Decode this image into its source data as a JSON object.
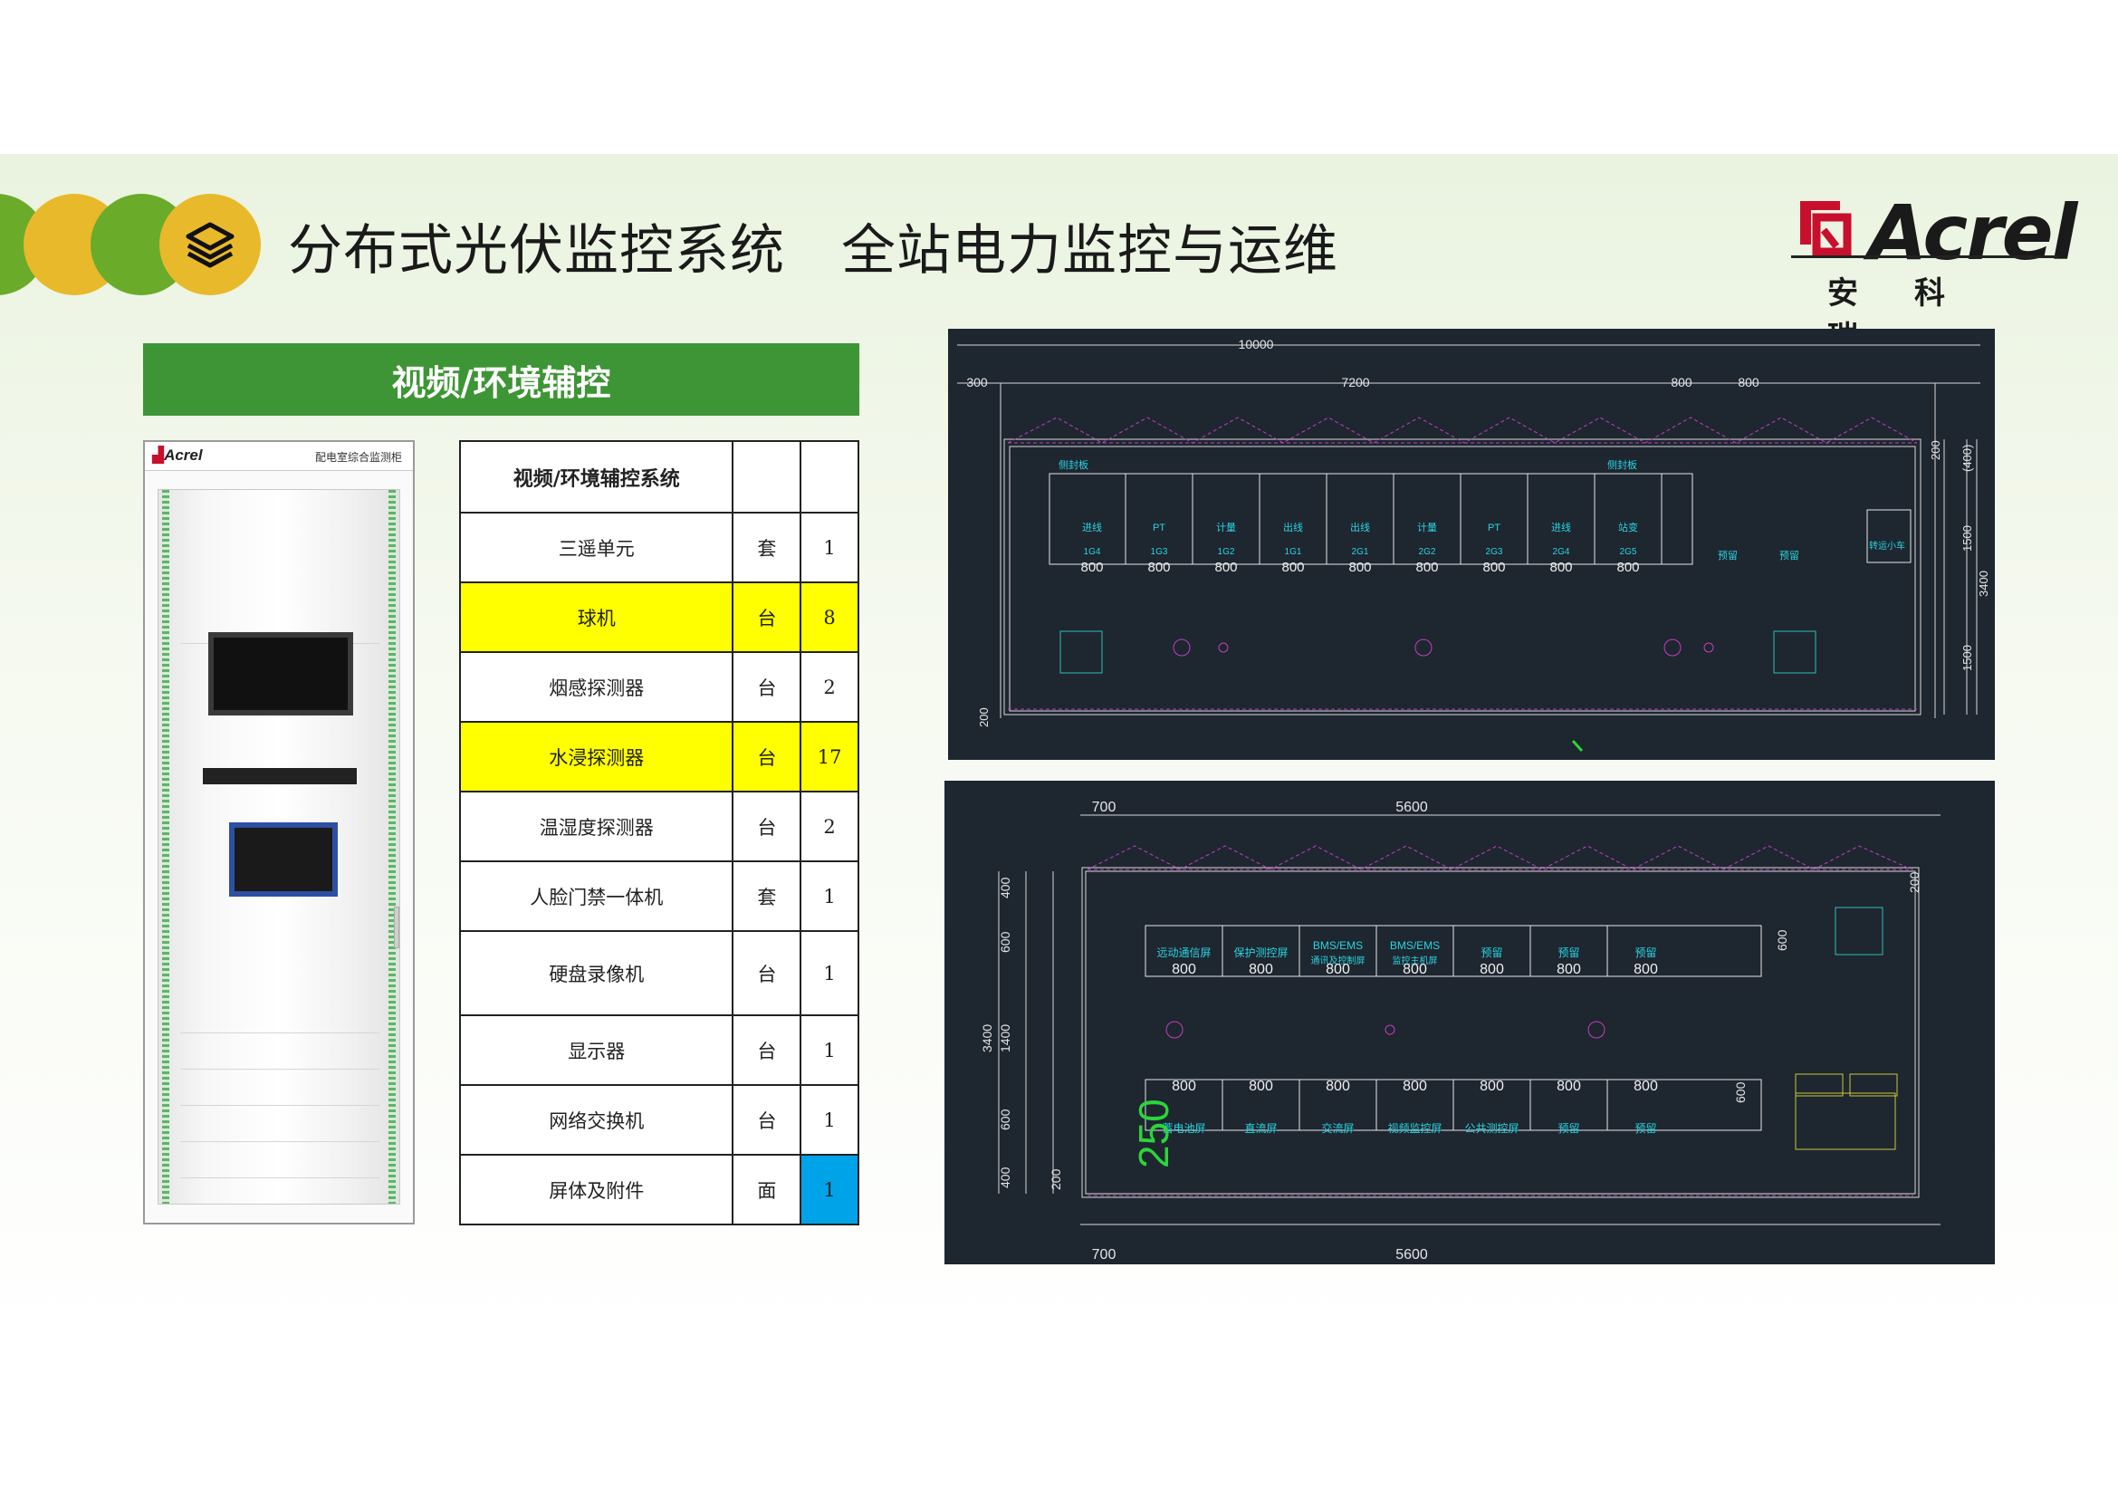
{
  "header": {
    "title_left": "分布式光伏监控系统",
    "title_right": "全站电力监控与运维",
    "layers_icon": "layers-icon",
    "circle_colors": [
      "#6aab2a",
      "#e8b92b",
      "#6aab2a",
      "#e8b92b"
    ]
  },
  "logo": {
    "word": "Acrel",
    "chinese": [
      "安",
      "科",
      "瑞"
    ],
    "mark_color": "#c8102e"
  },
  "section": {
    "title": "视频/环境辅控"
  },
  "cabinet": {
    "brand": "Acrel",
    "name": "配电室综合监测柜"
  },
  "table": {
    "header": "视频/环境辅控系统",
    "rows": [
      {
        "name": "三遥单元",
        "unit": "套",
        "qty": "1",
        "highlight": ""
      },
      {
        "name": "球机",
        "unit": "台",
        "qty": "8",
        "highlight": "yellow"
      },
      {
        "name": "烟感探测器",
        "unit": "台",
        "qty": "2",
        "highlight": ""
      },
      {
        "name": "水浸探测器",
        "unit": "台",
        "qty": "17",
        "highlight": "yellow"
      },
      {
        "name": "温湿度探测器",
        "unit": "台",
        "qty": "2",
        "highlight": ""
      },
      {
        "name": "人脸门禁一体机",
        "unit": "套",
        "qty": "1",
        "highlight": ""
      },
      {
        "name": "硬盘录像机",
        "unit": "台",
        "qty": "1",
        "highlight": ""
      },
      {
        "name": "显示器",
        "unit": "台",
        "qty": "1",
        "highlight": ""
      },
      {
        "name": "网络交换机",
        "unit": "台",
        "qty": "1",
        "highlight": ""
      },
      {
        "name": "屏体及附件",
        "unit": "面",
        "qty": "1",
        "highlight": "blue"
      }
    ]
  },
  "drawing1": {
    "dims_top": [
      "10000",
      "300",
      "7200",
      "800",
      "800"
    ],
    "side_dims": [
      "200",
      "(400)",
      "1500",
      "3400",
      "1500",
      "200"
    ],
    "panel_labels": [
      "侧封板",
      "侧封板"
    ],
    "cabinets": [
      {
        "type": "进线",
        "code": "1G4",
        "w": "800"
      },
      {
        "type": "PT",
        "code": "1G3",
        "w": "800"
      },
      {
        "type": "计量",
        "code": "1G2",
        "w": "800"
      },
      {
        "type": "出线",
        "code": "1G1",
        "w": "800"
      },
      {
        "type": "出线",
        "code": "2G1",
        "w": "800"
      },
      {
        "type": "计量",
        "code": "2G2",
        "w": "800"
      },
      {
        "type": "PT",
        "code": "2G3",
        "w": "800"
      },
      {
        "type": "进线",
        "code": "2G4",
        "w": "800"
      },
      {
        "type": "站变",
        "code": "2G5",
        "w": "800"
      }
    ],
    "reserve": [
      "预留",
      "预留"
    ],
    "cart": "转运小车"
  },
  "drawing2": {
    "dims_top": [
      "700",
      "5600"
    ],
    "dims_bottom": [
      "700",
      "5600"
    ],
    "side_dims": [
      "400",
      "600",
      "3400",
      "1400",
      "600",
      "400",
      "200"
    ],
    "right_dims": [
      "200",
      "600",
      "600"
    ],
    "row1": [
      {
        "label": "远动通信屏",
        "w": "800"
      },
      {
        "label": "保护测控屏",
        "w": "800"
      },
      {
        "label": "BMS/EMS",
        "sub": "通讯及控制屏",
        "w": "800"
      },
      {
        "label": "BMS/EMS",
        "sub": "监控主机屏",
        "w": "800"
      },
      {
        "label": "预留",
        "w": "800"
      },
      {
        "label": "预留",
        "w": "800"
      },
      {
        "label": "预留",
        "w": "800"
      }
    ],
    "row2": [
      {
        "label": "蓄电池屏",
        "w": "800"
      },
      {
        "label": "直流屏",
        "w": "800"
      },
      {
        "label": "交流屏",
        "w": "800"
      },
      {
        "label": "视频监控屏",
        "w": "800"
      },
      {
        "label": "公共测控屏",
        "w": "800"
      },
      {
        "label": "预留",
        "w": "800"
      },
      {
        "label": "预留",
        "w": "800"
      }
    ],
    "big_dim": "250"
  }
}
